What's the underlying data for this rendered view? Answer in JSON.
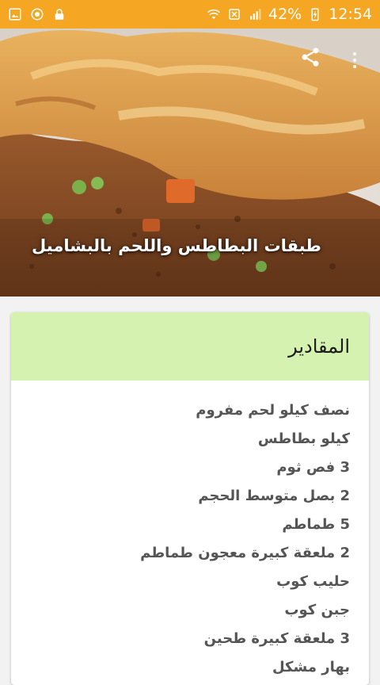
{
  "status_bar": {
    "battery": "42%",
    "time": "12:54",
    "left_icons": [
      "gallery-icon",
      "app-badge-icon",
      "lock-icon"
    ],
    "right_icons": [
      "wifi-icon",
      "data-saver-icon",
      "signal-icon",
      "battery-charging-icon"
    ]
  },
  "hero": {
    "title": "طبقات البطاطس واللحم بالبشاميل",
    "actions": [
      "share-icon",
      "more-vert-icon"
    ]
  },
  "card": {
    "title": "المقادير",
    "header_color": "#d6f2b0",
    "ingredients": [
      "نصف كيلو لحم مفروم",
      "كيلو بطاطس",
      "3 فص ثوم",
      "2 بصل متوسط الحجم",
      "5 طماطم",
      "2 ملعقة كبيرة معجون طماطم",
      "حليب كوب",
      "جبن كوب",
      "3 ملعقة كبيرة طحين",
      "بهار مشكل"
    ]
  },
  "colors": {
    "status_bar": "#f5a623"
  }
}
